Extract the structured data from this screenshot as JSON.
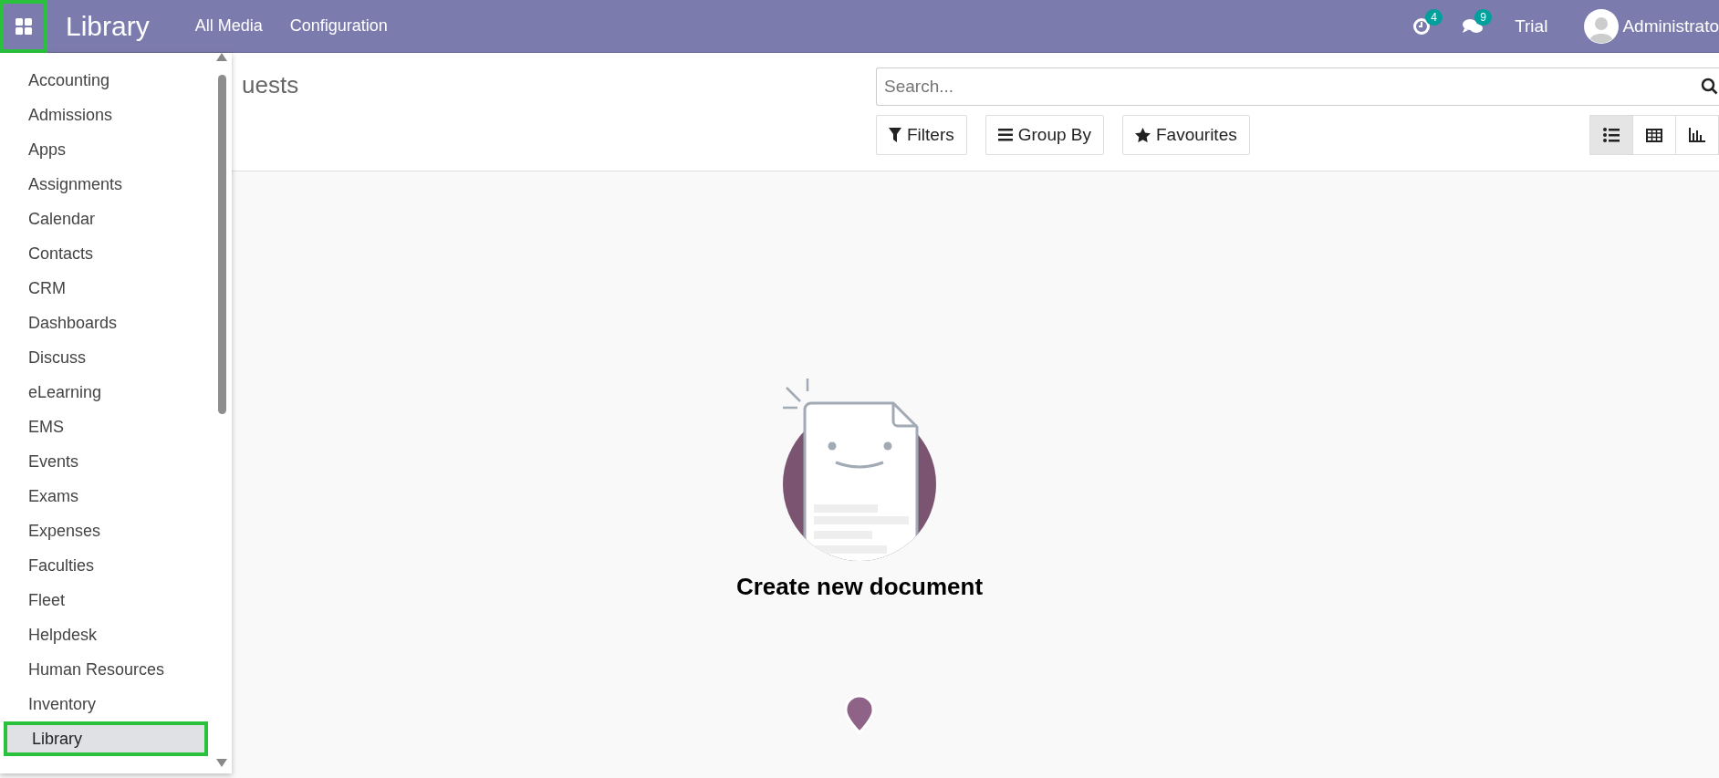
{
  "navbar": {
    "app_switcher": {
      "highlighted": true
    },
    "app_title": "Library",
    "menu": [
      "All Media",
      "Configuration"
    ],
    "activity_count": "4",
    "message_count": "9",
    "trial_label": "Trial",
    "user_name": "Administrato"
  },
  "app_menu": {
    "items": [
      {
        "label": "Accounting",
        "selected": false
      },
      {
        "label": "Admissions",
        "selected": false
      },
      {
        "label": "Apps",
        "selected": false
      },
      {
        "label": "Assignments",
        "selected": false
      },
      {
        "label": "Calendar",
        "selected": false
      },
      {
        "label": "Contacts",
        "selected": false
      },
      {
        "label": "CRM",
        "selected": false
      },
      {
        "label": "Dashboards",
        "selected": false
      },
      {
        "label": "Discuss",
        "selected": false
      },
      {
        "label": "eLearning",
        "selected": false
      },
      {
        "label": "EMS",
        "selected": false
      },
      {
        "label": "Events",
        "selected": false
      },
      {
        "label": "Exams",
        "selected": false
      },
      {
        "label": "Expenses",
        "selected": false
      },
      {
        "label": "Faculties",
        "selected": false
      },
      {
        "label": "Fleet",
        "selected": false
      },
      {
        "label": "Helpdesk",
        "selected": false
      },
      {
        "label": "Human Resources",
        "selected": false
      },
      {
        "label": "Inventory",
        "selected": false
      },
      {
        "label": "Library",
        "selected": true
      }
    ]
  },
  "control_panel": {
    "breadcrumb": "uests",
    "search": {
      "placeholder": "Search..."
    },
    "buttons": [
      {
        "kind": "filter",
        "label": "Filters"
      },
      {
        "kind": "group",
        "label": "Group By"
      },
      {
        "kind": "favourite",
        "label": "Favourites"
      }
    ],
    "views": [
      {
        "kind": "list",
        "selected": true
      },
      {
        "kind": "grid",
        "selected": false
      },
      {
        "kind": "graph",
        "selected": false
      }
    ]
  },
  "empty_state": {
    "title": "Create new document"
  }
}
